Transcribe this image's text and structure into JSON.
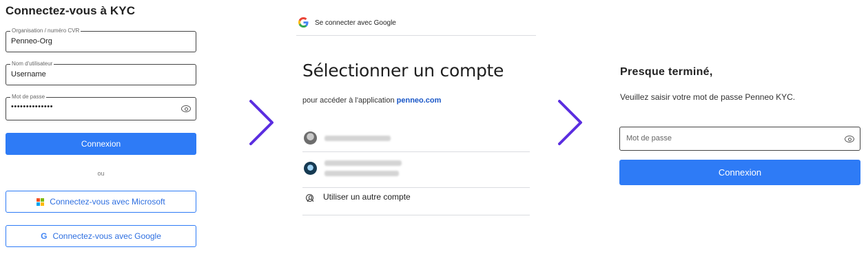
{
  "panel1": {
    "title": "Connectez-vous à KYC",
    "org_field": {
      "legend": "Organisation / numéro CVR",
      "value": "Penneo-Org"
    },
    "user_field": {
      "legend": "Nom d'utilisateur",
      "value": "Username"
    },
    "pass_field": {
      "legend": "Mot de passe",
      "value": "••••••••••••••"
    },
    "login_button": "Connexion",
    "or_text": "ou",
    "microsoft_button": "Connectez-vous avec Microsoft",
    "google_button": "Connectez-vous avec Google",
    "colors": {
      "primary": "#2e7bf6",
      "outline_text": "#2e6fe0"
    }
  },
  "arrows": {
    "color": "#5b2ee0"
  },
  "panel2": {
    "topbar_text": "Se connecter avec Google",
    "heading": "Sélectionner un compte",
    "sub_prefix": "pour accéder à l'application ",
    "sub_link": "penneo.com",
    "other_account": "Utiliser un autre compte",
    "link_color": "#1a57c7"
  },
  "panel3": {
    "title": "Presque terminé,",
    "subtitle": "Veuillez saisir votre mot de passe Penneo KYC.",
    "password_placeholder": "Mot de passe",
    "login_button": "Connexion"
  }
}
